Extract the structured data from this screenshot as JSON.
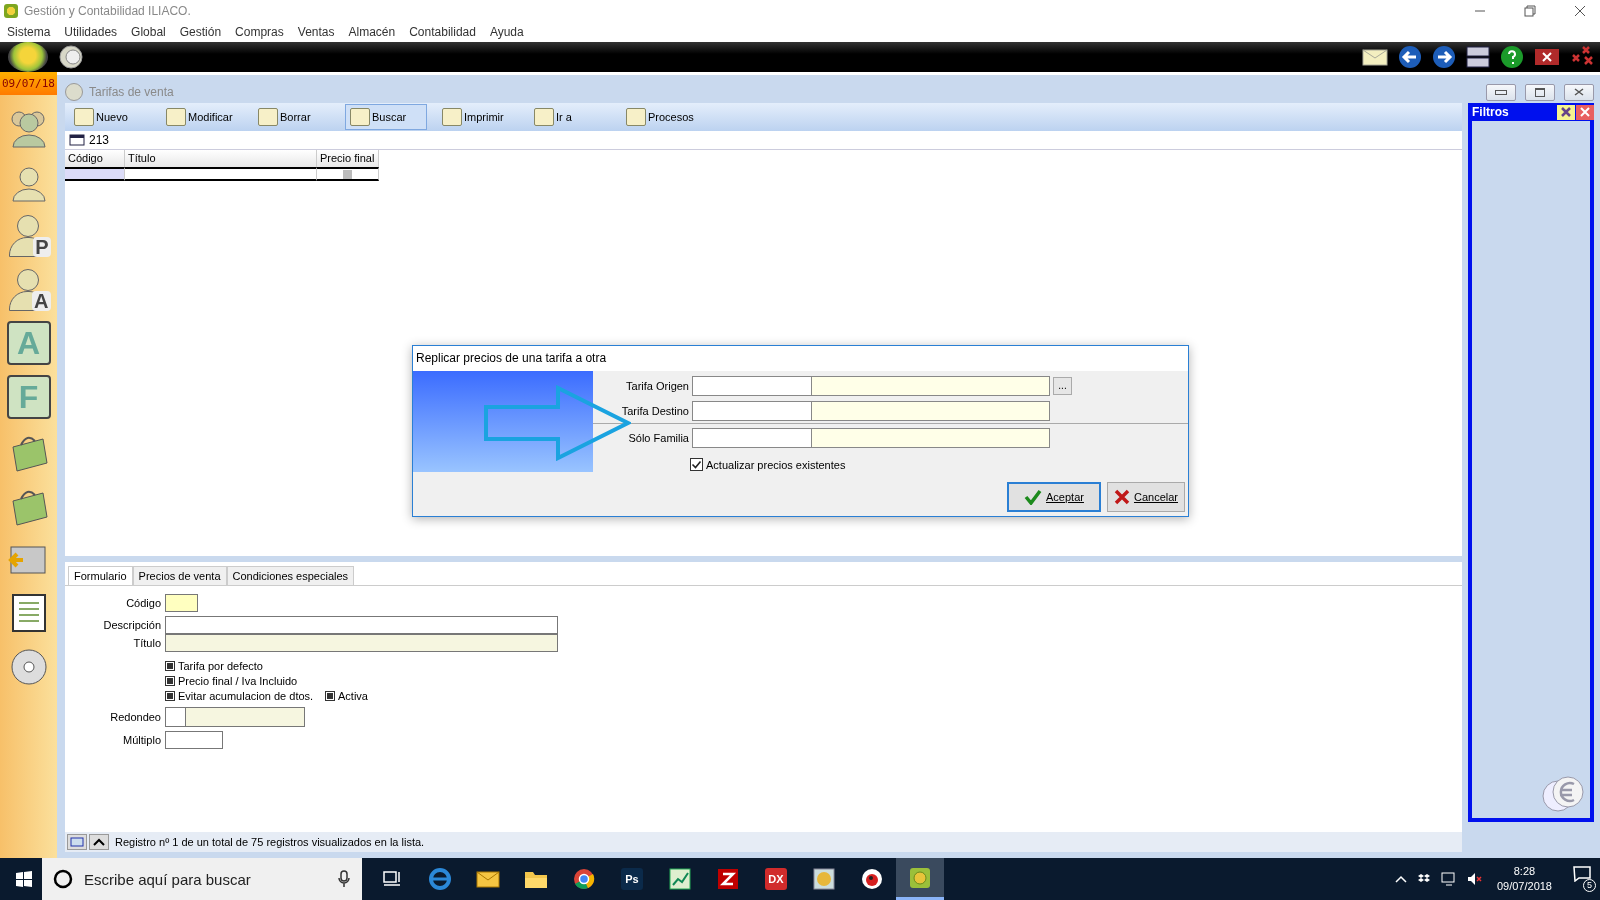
{
  "window": {
    "title": "Gestión y Contabilidad ILIACO."
  },
  "menu": [
    "Sistema",
    "Utilidades",
    "Global",
    "Gestión",
    "Compras",
    "Ventas",
    "Almacén",
    "Contabilidad",
    "Ayuda"
  ],
  "date": "09/07/18",
  "sidebar": [
    {
      "kind": "people"
    },
    {
      "kind": "person"
    },
    {
      "kind": "letter-person",
      "glyph": "P"
    },
    {
      "kind": "letter-person",
      "glyph": "A"
    },
    {
      "kind": "letter",
      "glyph": "A"
    },
    {
      "kind": "letter",
      "glyph": "F"
    },
    {
      "kind": "bag"
    },
    {
      "kind": "bag"
    },
    {
      "kind": "card"
    },
    {
      "kind": "list"
    },
    {
      "kind": "disc"
    }
  ],
  "child": {
    "title": "Tarifas de venta",
    "toolbar": [
      {
        "label": "Nuevo",
        "selected": false
      },
      {
        "label": "Modificar",
        "selected": false
      },
      {
        "label": "Borrar",
        "selected": false
      },
      {
        "label": "Buscar",
        "selected": true
      },
      {
        "label": "Imprimir",
        "selected": false
      },
      {
        "label": "Ir a",
        "selected": false
      },
      {
        "label": "Procesos",
        "selected": false
      }
    ],
    "count": "213",
    "table": {
      "columns": [
        "Código",
        "Título",
        "Precio final"
      ]
    },
    "tabs": [
      {
        "label": "Formulario",
        "selected": true
      },
      {
        "label": "Precios de venta",
        "selected": false
      },
      {
        "label": "Condiciones especiales",
        "selected": false
      }
    ],
    "form": {
      "codigo": "Código",
      "descripcion": "Descripción",
      "titulo": "Título",
      "checks": [
        {
          "label": "Tarifa por defecto",
          "checked": true
        },
        {
          "label": "Precio final / Iva Incluido",
          "checked": true
        },
        {
          "label": "Evitar acumulacion de dtos.",
          "checked": true
        },
        {
          "label": "Activa",
          "checked": true
        }
      ],
      "redondeo": "Redondeo",
      "multiplo": "Múltiplo"
    },
    "status": "Registro nº 1 de un total de 75 registros visualizados en la lista."
  },
  "filters": {
    "title": "Filtros"
  },
  "dialog": {
    "title": "Replicar precios de una tarifa a otra",
    "fields": [
      {
        "label": "Tarifa Origen",
        "browse": "..."
      },
      {
        "label": "Tarifa Destino"
      },
      {
        "label": "Sólo Familia"
      }
    ],
    "check": {
      "label": "Actualizar precios existentes",
      "checked": true
    },
    "ok": "Aceptar",
    "cancel": "Cancelar"
  },
  "taskbar": {
    "search": {
      "placeholder": "Escribe aquí para buscar"
    },
    "apps": [
      {
        "kind": "taskview"
      },
      {
        "kind": "edge"
      },
      {
        "kind": "mail"
      },
      {
        "kind": "folder"
      },
      {
        "kind": "chrome"
      },
      {
        "kind": "text",
        "label": "Ps",
        "color": "#0b2a4a"
      },
      {
        "kind": "chart"
      },
      {
        "kind": "filezilla"
      },
      {
        "kind": "text",
        "label": "DX",
        "color": "#d12b2b"
      },
      {
        "kind": "coin"
      },
      {
        "kind": "bird"
      },
      {
        "kind": "app",
        "selected": true
      }
    ],
    "time": "8:28",
    "date": "09/07/2018",
    "notifications": "5"
  }
}
